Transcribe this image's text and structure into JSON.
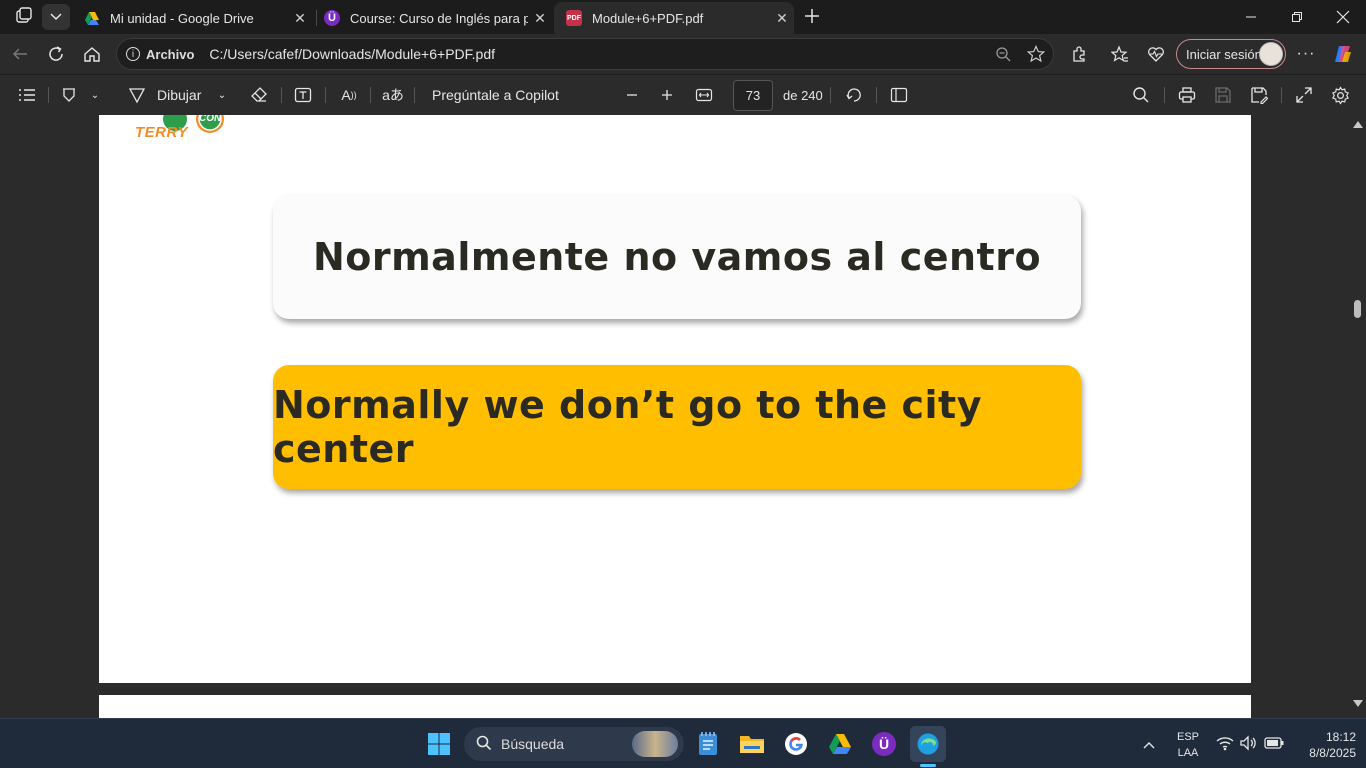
{
  "tabs": [
    {
      "title": "Mi unidad - Google Drive",
      "close": "✕"
    },
    {
      "title": "Course: Curso de Inglés para principiantes",
      "close": "✕"
    },
    {
      "title": "Module+6+PDF.pdf",
      "close": "✕"
    }
  ],
  "address": {
    "label": "Archivo",
    "url": "C:/Users/cafef/Downloads/Module+6+PDF.pdf",
    "signin": "Iniciar sesión"
  },
  "pdf_toolbar": {
    "draw_label": "Dibujar",
    "copilot_label": "Pregúntale a Copilot",
    "page_current": "73",
    "page_total": "de 240"
  },
  "page": {
    "logo_text": "TERRY",
    "logo_badge": "CON",
    "spanish_sentence": "Normalmente no vamos al centro",
    "english_sentence": "Normally we don’t go to the city center",
    "card_color": "#ffbf00"
  },
  "taskbar": {
    "search_placeholder": "Búsqueda",
    "lang_top": "ESP",
    "lang_bottom": "LAA",
    "time": "18:12",
    "date": "8/8/2025"
  },
  "icons": [
    "workspaces-icon",
    "tab-list-icon",
    "drive-icon",
    "course-icon",
    "pdf-icon",
    "new-tab-icon",
    "minimize-icon",
    "restore-icon",
    "close-icon",
    "back-icon",
    "refresh-icon",
    "home-icon",
    "info-icon",
    "zoom-icon",
    "favorite-icon",
    "extensions-icon",
    "favorites-icon",
    "health-icon",
    "menu-icon",
    "copilot-icon",
    "contents-icon",
    "highlight-icon",
    "draw-icon",
    "erase-icon",
    "text-icon",
    "read-aloud-icon",
    "translate-icon",
    "zoom-out-icon",
    "zoom-in-icon",
    "fit-icon",
    "rotate-icon",
    "page-view-icon",
    "search-icon",
    "print-icon",
    "save-icon",
    "save-as-icon",
    "fullscreen-icon",
    "settings-icon",
    "windows-icon",
    "notepad-icon",
    "explorer-icon",
    "google-icon",
    "edge-icon",
    "wifi-icon",
    "volume-icon",
    "battery-icon",
    "chevron-up-icon"
  ]
}
